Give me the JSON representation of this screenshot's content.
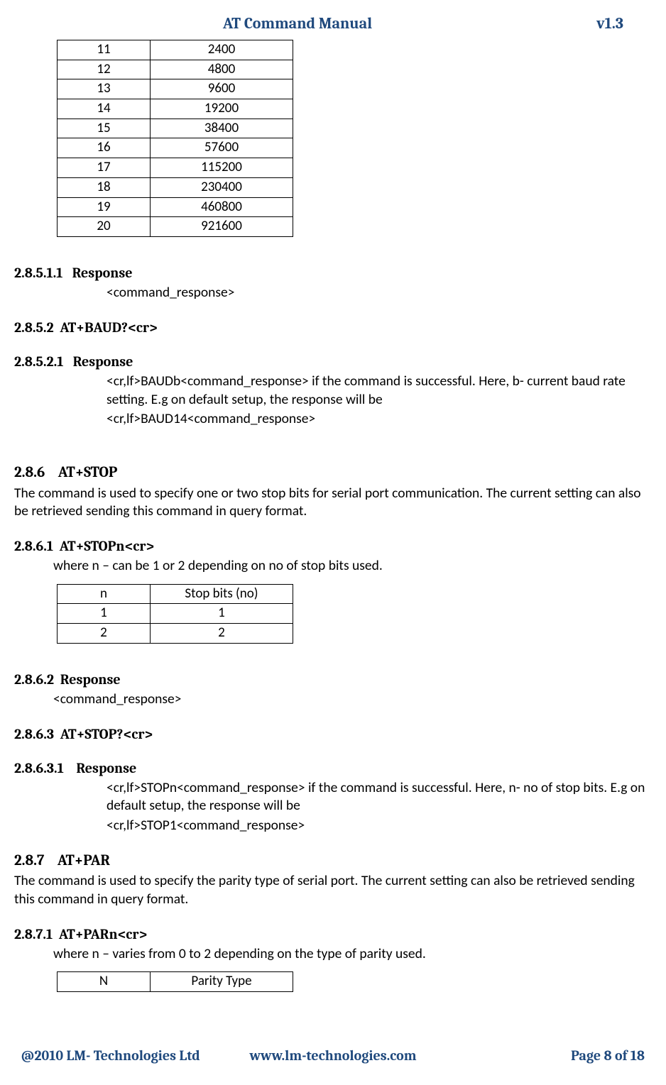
{
  "header": {
    "title": "AT Command Manual",
    "version": "v1.3"
  },
  "baud_table": {
    "rows": [
      {
        "b": "11",
        "rate": "2400"
      },
      {
        "b": "12",
        "rate": "4800"
      },
      {
        "b": "13",
        "rate": "9600"
      },
      {
        "b": "14",
        "rate": "19200"
      },
      {
        "b": "15",
        "rate": "38400"
      },
      {
        "b": "16",
        "rate": "57600"
      },
      {
        "b": "17",
        "rate": "115200"
      },
      {
        "b": "18",
        "rate": "230400"
      },
      {
        "b": "19",
        "rate": "460800"
      },
      {
        "b": "20",
        "rate": "921600"
      }
    ]
  },
  "s28511": {
    "num": "2.8.5.1.1",
    "title": "Response",
    "text": "<command_response>"
  },
  "s2852": {
    "num": "2.8.5.2",
    "title": "AT+BAUD?<cr>"
  },
  "s28521": {
    "num": "2.8.5.2.1",
    "title": "Response",
    "line1": "<cr,lf>BAUDb<command_response>  if the command is successful. Here, b- current baud rate setting. E.g on default setup, the response will be",
    "line2": "<cr,lf>BAUD14<command_response>"
  },
  "s286": {
    "num": "2.8.6",
    "title": "AT+STOP",
    "desc": "The command is used to specify one or two stop bits for serial port communication. The current setting can also be retrieved sending this command in query format."
  },
  "s2861": {
    "num": "2.8.6.1",
    "title": "AT+STOPn<cr>",
    "desc": "where n – can be 1 or 2 depending on no of stop bits used."
  },
  "stop_table": {
    "head": {
      "n": "n",
      "bits": "Stop bits (no)"
    },
    "rows": [
      {
        "n": "1",
        "bits": "1"
      },
      {
        "n": "2",
        "bits": "2"
      }
    ]
  },
  "s2862": {
    "num": "2.8.6.2",
    "title": "Response",
    "text": "<command_response>"
  },
  "s2863": {
    "num": "2.8.6.3",
    "title": "AT+STOP?<cr>"
  },
  "s28631": {
    "num": "2.8.6.3.1",
    "title": "Response",
    "line1": "<cr,lf>STOPn<command_response>  if the command is successful. Here, n- no of stop bits. E.g on default setup, the response will be",
    "line2": "<cr,lf>STOP1<command_response>"
  },
  "s287": {
    "num": "2.8.7",
    "title": "AT+PAR",
    "desc": "The command is used to specify the parity type of serial port. The current setting can also be retrieved sending this command in query format."
  },
  "s2871": {
    "num": "2.8.7.1",
    "title": "AT+PARn<cr>",
    "desc": "where n – varies from 0 to 2 depending on the type of parity used."
  },
  "parity_table": {
    "head": {
      "n": "N",
      "type": "Parity Type"
    }
  },
  "footer": {
    "left": "@2010 LM- Technologies Ltd",
    "mid": "www.lm-technologies.com",
    "right": "Page 8 of 18"
  }
}
